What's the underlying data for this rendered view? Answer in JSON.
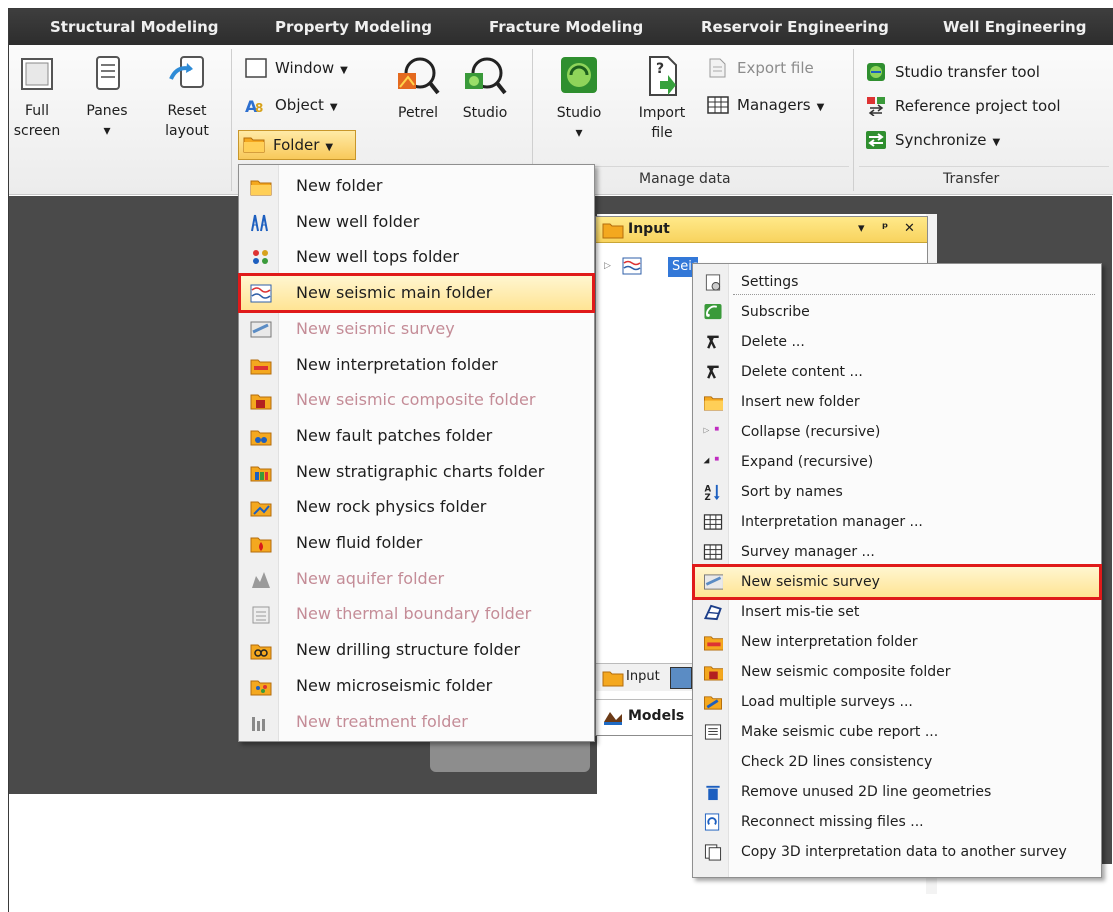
{
  "ribbon_tabs": [
    "Structural Modeling",
    "Property Modeling",
    "Fracture Modeling",
    "Reservoir Engineering",
    "Well Engineering"
  ],
  "ribbon": {
    "full_screen": {
      "line1": "Full",
      "line2": "screen"
    },
    "panes": {
      "line1": "Panes",
      "line2": "▾"
    },
    "reset_layout": {
      "line1": "Reset",
      "line2": "layout"
    },
    "window": "Window",
    "object": "Object",
    "folder": "Folder",
    "petrel": "Petrel",
    "studio": "Studio",
    "studio2": {
      "line1": "Studio",
      "line2": "▾"
    },
    "import_file": {
      "line1": "Import",
      "line2": "file"
    },
    "export_file": "Export file",
    "managers": "Managers",
    "manage_data_label": "Manage data",
    "studio_transfer_tool": "Studio transfer tool",
    "reference_project_tool": "Reference project tool",
    "synchronize": "Synchronize",
    "transfer_label": "Transfer"
  },
  "folder_menu": [
    {
      "label": "New folder",
      "icon": "folder-icon",
      "disabled": false
    },
    {
      "label": "New well folder",
      "icon": "well-folder-icon",
      "disabled": false
    },
    {
      "label": "New well tops folder",
      "icon": "well-tops-icon",
      "disabled": false
    },
    {
      "label": "New seismic main folder",
      "icon": "seismic-main-icon",
      "disabled": false,
      "highlighted": true
    },
    {
      "label": "New seismic survey",
      "icon": "seismic-survey-icon",
      "disabled": true
    },
    {
      "label": "New interpretation folder",
      "icon": "interpretation-folder-icon",
      "disabled": false
    },
    {
      "label": "New seismic composite folder",
      "icon": "seismic-composite-icon",
      "disabled": true
    },
    {
      "label": "New fault patches folder",
      "icon": "fault-patches-icon",
      "disabled": false
    },
    {
      "label": "New stratigraphic charts folder",
      "icon": "stratigraphic-charts-icon",
      "disabled": false
    },
    {
      "label": "New rock physics folder",
      "icon": "rock-physics-icon",
      "disabled": false
    },
    {
      "label": "New fluid folder",
      "icon": "fluid-folder-icon",
      "disabled": false
    },
    {
      "label": "New aquifer folder",
      "icon": "aquifer-icon",
      "disabled": true
    },
    {
      "label": "New thermal boundary folder",
      "icon": "thermal-boundary-icon",
      "disabled": true
    },
    {
      "label": "New drilling structure folder",
      "icon": "drilling-structure-icon",
      "disabled": false
    },
    {
      "label": "New microseismic folder",
      "icon": "microseismic-icon",
      "disabled": false
    },
    {
      "label": "New treatment folder",
      "icon": "treatment-folder-icon",
      "disabled": true
    }
  ],
  "input_panel": {
    "title": "Input",
    "tree_node": "Seis",
    "tab_input": "Input",
    "tab_models": "Models"
  },
  "context_menu": [
    {
      "label": "Settings",
      "icon": "settings-icon"
    },
    {
      "label": "Subscribe",
      "icon": "subscribe-icon"
    },
    {
      "label": "Delete ...",
      "icon": "delete-icon"
    },
    {
      "label": "Delete content ...",
      "icon": "delete-content-icon"
    },
    {
      "label": "Insert new folder",
      "icon": "folder-icon"
    },
    {
      "label": "Collapse (recursive)",
      "icon": "collapse-icon"
    },
    {
      "label": "Expand (recursive)",
      "icon": "expand-icon"
    },
    {
      "label": "Sort by names",
      "icon": "sort-az-icon"
    },
    {
      "label": "Interpretation manager ...",
      "icon": "table-icon"
    },
    {
      "label": "Survey manager ...",
      "icon": "table-icon"
    },
    {
      "label": "New seismic survey",
      "icon": "seismic-survey-icon",
      "highlighted": true
    },
    {
      "label": "Insert mis-tie set",
      "icon": "mis-tie-icon"
    },
    {
      "label": "New interpretation folder",
      "icon": "interpretation-folder-icon"
    },
    {
      "label": "New seismic composite folder",
      "icon": "seismic-composite-icon"
    },
    {
      "label": "Load multiple surveys ...",
      "icon": "load-surveys-icon"
    },
    {
      "label": "Make seismic cube report ...",
      "icon": "report-icon"
    },
    {
      "label": "Check 2D lines consistency",
      "icon": ""
    },
    {
      "label": "Remove unused 2D line geometries",
      "icon": "trash-icon"
    },
    {
      "label": "Reconnect missing files ...",
      "icon": "reconnect-icon"
    },
    {
      "label": "Copy 3D interpretation data to another survey",
      "icon": "copy-icon"
    }
  ]
}
